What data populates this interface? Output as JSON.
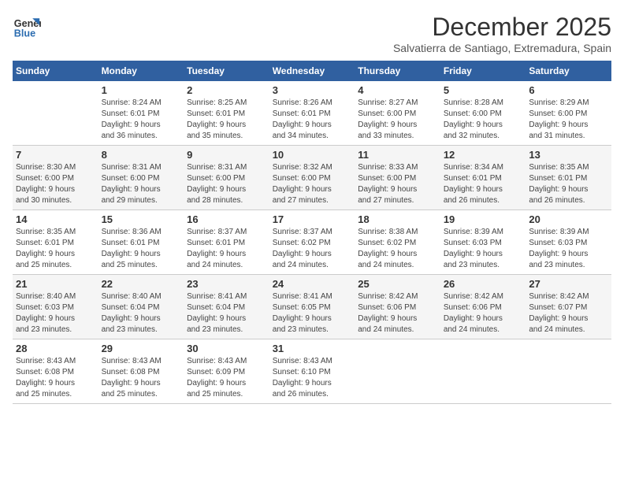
{
  "logo": {
    "line1": "General",
    "line2": "Blue"
  },
  "title": "December 2025",
  "subtitle": "Salvatierra de Santiago, Extremadura, Spain",
  "days_of_week": [
    "Sunday",
    "Monday",
    "Tuesday",
    "Wednesday",
    "Thursday",
    "Friday",
    "Saturday"
  ],
  "weeks": [
    [
      {
        "day": "",
        "info": ""
      },
      {
        "day": "1",
        "info": "Sunrise: 8:24 AM\nSunset: 6:01 PM\nDaylight: 9 hours\nand 36 minutes."
      },
      {
        "day": "2",
        "info": "Sunrise: 8:25 AM\nSunset: 6:01 PM\nDaylight: 9 hours\nand 35 minutes."
      },
      {
        "day": "3",
        "info": "Sunrise: 8:26 AM\nSunset: 6:01 PM\nDaylight: 9 hours\nand 34 minutes."
      },
      {
        "day": "4",
        "info": "Sunrise: 8:27 AM\nSunset: 6:00 PM\nDaylight: 9 hours\nand 33 minutes."
      },
      {
        "day": "5",
        "info": "Sunrise: 8:28 AM\nSunset: 6:00 PM\nDaylight: 9 hours\nand 32 minutes."
      },
      {
        "day": "6",
        "info": "Sunrise: 8:29 AM\nSunset: 6:00 PM\nDaylight: 9 hours\nand 31 minutes."
      }
    ],
    [
      {
        "day": "7",
        "info": "Sunrise: 8:30 AM\nSunset: 6:00 PM\nDaylight: 9 hours\nand 30 minutes."
      },
      {
        "day": "8",
        "info": "Sunrise: 8:31 AM\nSunset: 6:00 PM\nDaylight: 9 hours\nand 29 minutes."
      },
      {
        "day": "9",
        "info": "Sunrise: 8:31 AM\nSunset: 6:00 PM\nDaylight: 9 hours\nand 28 minutes."
      },
      {
        "day": "10",
        "info": "Sunrise: 8:32 AM\nSunset: 6:00 PM\nDaylight: 9 hours\nand 27 minutes."
      },
      {
        "day": "11",
        "info": "Sunrise: 8:33 AM\nSunset: 6:00 PM\nDaylight: 9 hours\nand 27 minutes."
      },
      {
        "day": "12",
        "info": "Sunrise: 8:34 AM\nSunset: 6:01 PM\nDaylight: 9 hours\nand 26 minutes."
      },
      {
        "day": "13",
        "info": "Sunrise: 8:35 AM\nSunset: 6:01 PM\nDaylight: 9 hours\nand 26 minutes."
      }
    ],
    [
      {
        "day": "14",
        "info": "Sunrise: 8:35 AM\nSunset: 6:01 PM\nDaylight: 9 hours\nand 25 minutes."
      },
      {
        "day": "15",
        "info": "Sunrise: 8:36 AM\nSunset: 6:01 PM\nDaylight: 9 hours\nand 25 minutes."
      },
      {
        "day": "16",
        "info": "Sunrise: 8:37 AM\nSunset: 6:01 PM\nDaylight: 9 hours\nand 24 minutes."
      },
      {
        "day": "17",
        "info": "Sunrise: 8:37 AM\nSunset: 6:02 PM\nDaylight: 9 hours\nand 24 minutes."
      },
      {
        "day": "18",
        "info": "Sunrise: 8:38 AM\nSunset: 6:02 PM\nDaylight: 9 hours\nand 24 minutes."
      },
      {
        "day": "19",
        "info": "Sunrise: 8:39 AM\nSunset: 6:03 PM\nDaylight: 9 hours\nand 23 minutes."
      },
      {
        "day": "20",
        "info": "Sunrise: 8:39 AM\nSunset: 6:03 PM\nDaylight: 9 hours\nand 23 minutes."
      }
    ],
    [
      {
        "day": "21",
        "info": "Sunrise: 8:40 AM\nSunset: 6:03 PM\nDaylight: 9 hours\nand 23 minutes."
      },
      {
        "day": "22",
        "info": "Sunrise: 8:40 AM\nSunset: 6:04 PM\nDaylight: 9 hours\nand 23 minutes."
      },
      {
        "day": "23",
        "info": "Sunrise: 8:41 AM\nSunset: 6:04 PM\nDaylight: 9 hours\nand 23 minutes."
      },
      {
        "day": "24",
        "info": "Sunrise: 8:41 AM\nSunset: 6:05 PM\nDaylight: 9 hours\nand 23 minutes."
      },
      {
        "day": "25",
        "info": "Sunrise: 8:42 AM\nSunset: 6:06 PM\nDaylight: 9 hours\nand 24 minutes."
      },
      {
        "day": "26",
        "info": "Sunrise: 8:42 AM\nSunset: 6:06 PM\nDaylight: 9 hours\nand 24 minutes."
      },
      {
        "day": "27",
        "info": "Sunrise: 8:42 AM\nSunset: 6:07 PM\nDaylight: 9 hours\nand 24 minutes."
      }
    ],
    [
      {
        "day": "28",
        "info": "Sunrise: 8:43 AM\nSunset: 6:08 PM\nDaylight: 9 hours\nand 25 minutes."
      },
      {
        "day": "29",
        "info": "Sunrise: 8:43 AM\nSunset: 6:08 PM\nDaylight: 9 hours\nand 25 minutes."
      },
      {
        "day": "30",
        "info": "Sunrise: 8:43 AM\nSunset: 6:09 PM\nDaylight: 9 hours\nand 25 minutes."
      },
      {
        "day": "31",
        "info": "Sunrise: 8:43 AM\nSunset: 6:10 PM\nDaylight: 9 hours\nand 26 minutes."
      },
      {
        "day": "",
        "info": ""
      },
      {
        "day": "",
        "info": ""
      },
      {
        "day": "",
        "info": ""
      }
    ]
  ]
}
